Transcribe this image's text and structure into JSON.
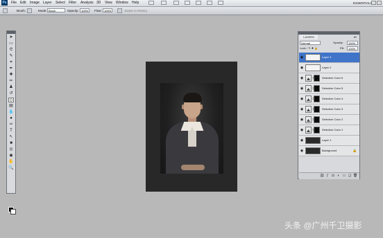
{
  "app": {
    "logo": "Ps",
    "workspace": "ESSENTIALS ▾"
  },
  "menubar": [
    "File",
    "Edit",
    "Image",
    "Layer",
    "Select",
    "Filter",
    "Analysis",
    "3D",
    "View",
    "Window",
    "Help"
  ],
  "options": {
    "brush_label": "Brush:",
    "mode_label": "Mode:",
    "mode_value": "Brush",
    "opacity_label": "Opacity:",
    "opacity_value": "100%",
    "flow_label": "Flow:",
    "flow_value": "100%",
    "erase_to_history": "Erase to History"
  },
  "layers_panel": {
    "tab": "LAYERS",
    "menu": "▾≡",
    "blend_mode": "Normal",
    "opacity_label": "Opacity:",
    "opacity_value": "100%",
    "lock_label": "Lock:",
    "fill_label": "Fill:",
    "fill_value": "100%",
    "layers": [
      {
        "name": "Layer 3",
        "thumb": "white",
        "selected": true
      },
      {
        "name": "Layer 2",
        "thumb": "white",
        "selected": false
      },
      {
        "name": "Selective Color 6",
        "thumb": "adj",
        "selected": false
      },
      {
        "name": "Selective Color 5",
        "thumb": "adj",
        "selected": false
      },
      {
        "name": "Selective Color 4",
        "thumb": "adj",
        "selected": false
      },
      {
        "name": "Selective Color 3",
        "thumb": "adj",
        "selected": false
      },
      {
        "name": "Selective Color 2",
        "thumb": "adj",
        "selected": false
      },
      {
        "name": "Selective Color 1",
        "thumb": "adj",
        "selected": false
      },
      {
        "name": "Layer 1",
        "thumb": "dark",
        "selected": false
      },
      {
        "name": "Background",
        "thumb": "dark",
        "selected": false,
        "locked": true
      }
    ]
  },
  "watermark": "头条 @广州千卫摄影",
  "colors": {
    "canvas_bg": "#282828",
    "workspace_bg": "#b8b8b8",
    "selected_layer": "#3f74c9"
  }
}
